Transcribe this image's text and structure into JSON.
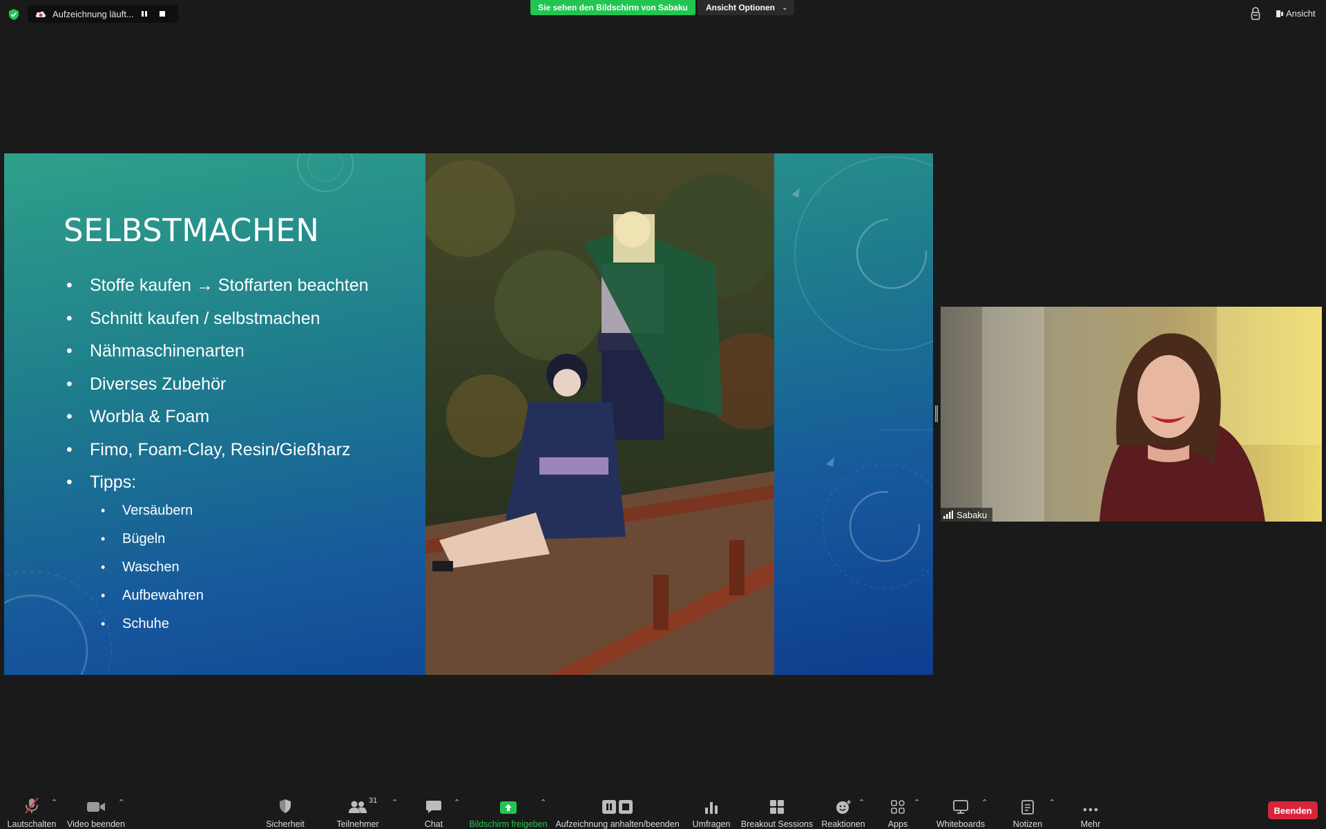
{
  "top": {
    "recording_status": "Aufzeichnung läuft...",
    "share_banner": "Sie sehen den Bildschirm von Sabaku",
    "view_options": "Ansicht Optionen",
    "view_button": "Ansicht"
  },
  "slide": {
    "title": "SELBSTMACHEN",
    "bullets": [
      "Stoffe kaufen → Stoffarten beachten",
      "Schnitt kaufen / selbstmachen",
      "Nähmaschinenarten",
      "Diverses Zubehör",
      "Worbla & Foam",
      "Fimo, Foam-Clay, Resin/Gießharz",
      "Tipps:"
    ],
    "sub_bullets": [
      "Versäubern",
      "Bügeln",
      "Waschen",
      "Aufbewahren",
      "Schuhe"
    ]
  },
  "participant": {
    "name": "Sabaku"
  },
  "toolbar": {
    "mute": "Lautschalten",
    "video": "Video beenden",
    "security": "Sicherheit",
    "participants": "Teilnehmer",
    "participants_count": "31",
    "chat": "Chat",
    "share": "Bildschirm freigeben",
    "recording": "Aufzeichnung anhalten/beenden",
    "polls": "Umfragen",
    "breakout": "Breakout Sessions",
    "reactions": "Reaktionen",
    "apps": "Apps",
    "whiteboards": "Whiteboards",
    "notes": "Notizen",
    "more": "Mehr",
    "end": "Beenden"
  },
  "colors": {
    "share_green": "#23c552",
    "end_red": "#d6263b",
    "background": "#1a1a1a"
  }
}
